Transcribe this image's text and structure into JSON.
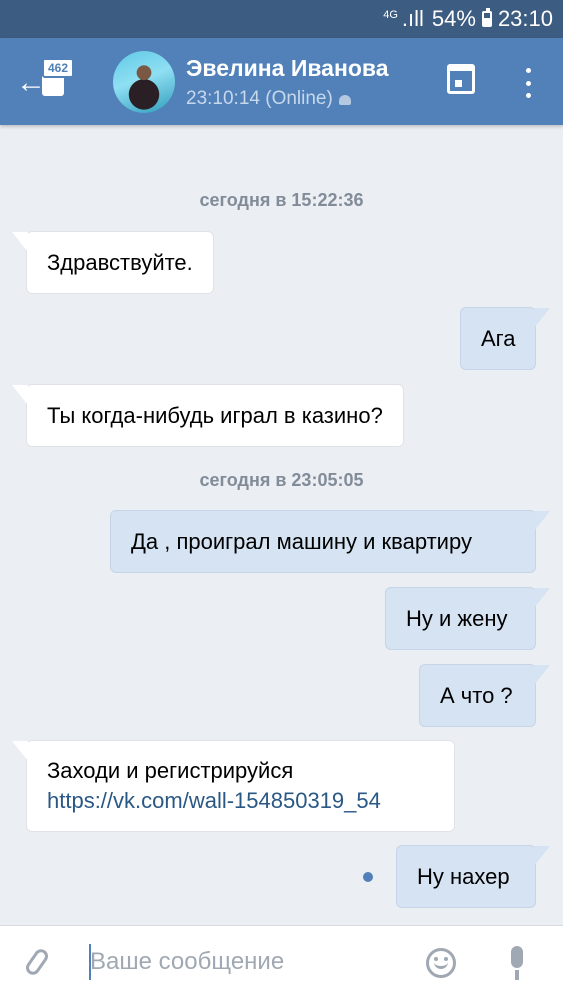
{
  "status": {
    "network": "4G",
    "signal": ".ıll",
    "battery": "54%",
    "time": "23:10"
  },
  "header": {
    "badge": "462",
    "back_arrow": "←",
    "name": "Эвелина Иванова",
    "presence": "23:10:14 (Online)",
    "icons": [
      "back-arrow-icon",
      "calendar-icon",
      "more-vertical-icon",
      "android-icon"
    ]
  },
  "chat": {
    "separators": [
      "сегодня в 15:22:36",
      "сегодня в 23:05:05"
    ],
    "messages": [
      {
        "dir": "in",
        "text": "Здравствуйте."
      },
      {
        "dir": "out",
        "text": "Ага"
      },
      {
        "dir": "in",
        "text": "Ты когда-нибудь играл в казино?"
      },
      {
        "dir": "out",
        "text": "Да , проиграл машину и квартиру"
      },
      {
        "dir": "out",
        "text": "Ну и жену"
      },
      {
        "dir": "out",
        "text": "А что ?"
      },
      {
        "dir": "in",
        "text": "Заходи и регистрируйся",
        "link": "https://vk.com/wall-154850319_54"
      },
      {
        "dir": "out",
        "text": "Ну нахер",
        "unread": true
      }
    ]
  },
  "composer": {
    "placeholder": "Ваше сообщение",
    "value": "",
    "icons": [
      "paperclip-icon",
      "smile-icon",
      "microphone-icon"
    ]
  },
  "colors": {
    "header": "#5181b8",
    "statusbar": "#3d5c82",
    "background": "#ebeef2",
    "incoming": "#ffffff",
    "outgoing": "#d6e3f2",
    "link": "#2a5885"
  }
}
